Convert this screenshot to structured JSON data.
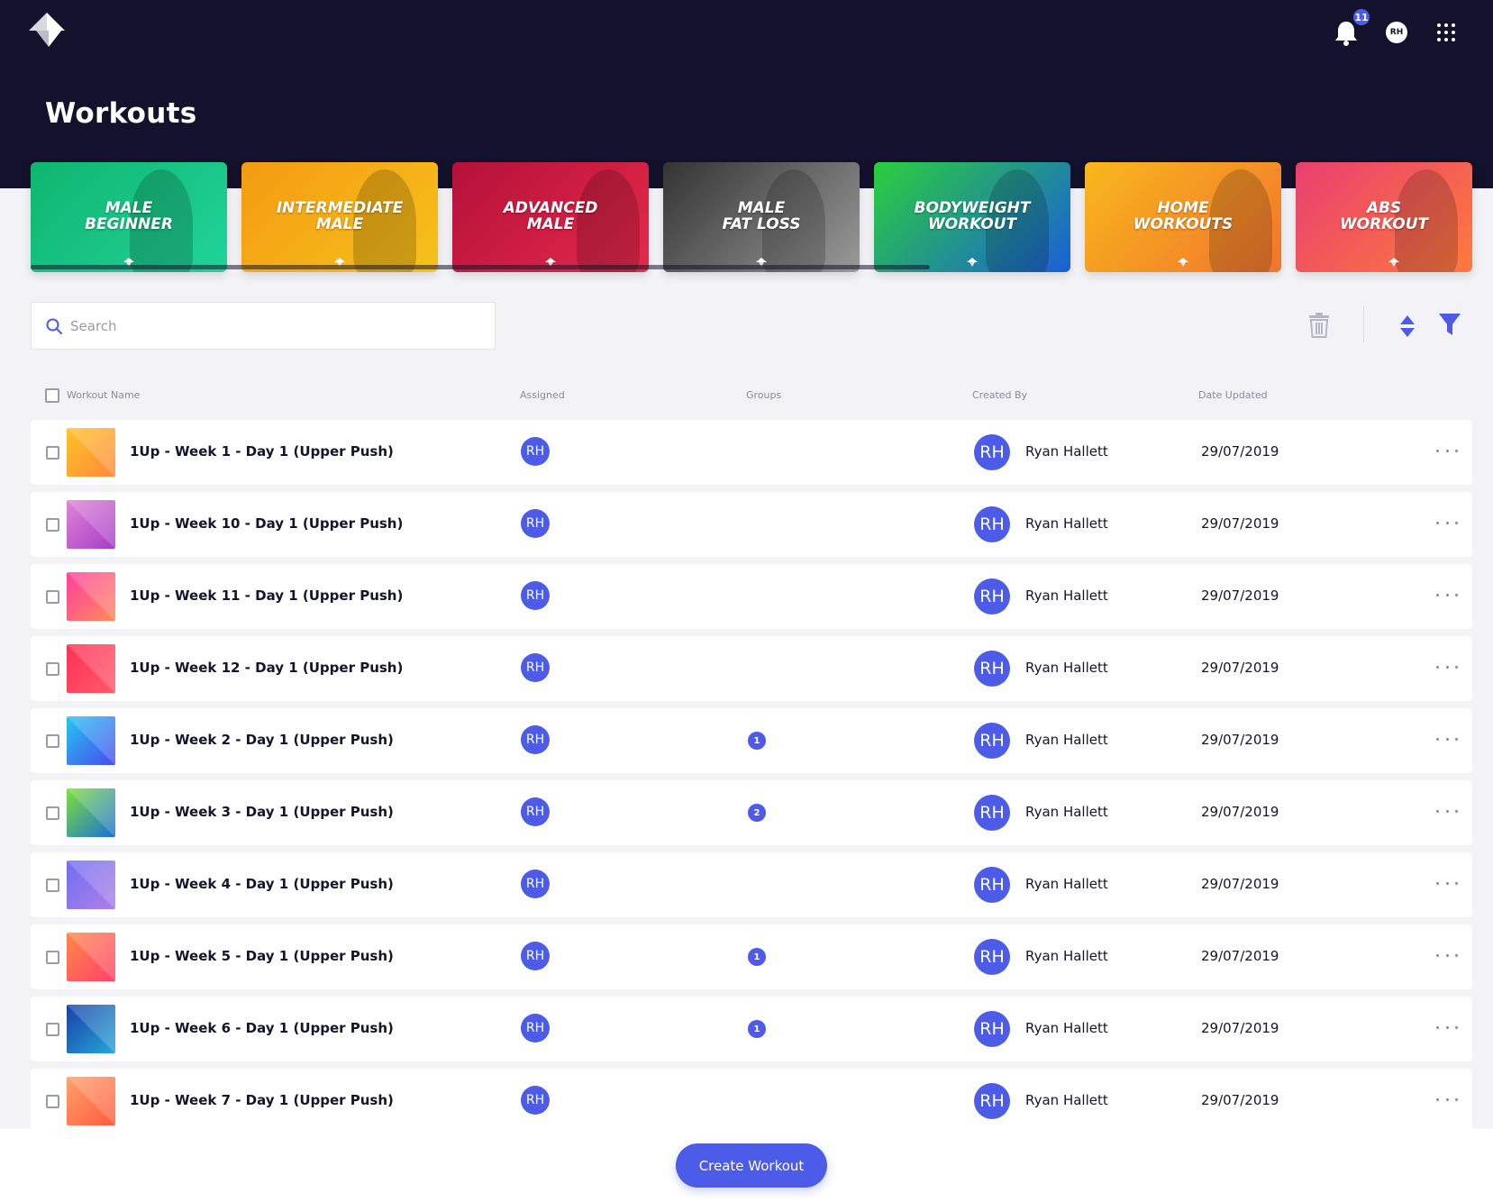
{
  "header": {
    "title": "Workouts",
    "notification_count": "11",
    "user_initials": "RH"
  },
  "categories": [
    {
      "label": "MALE\nBEGINNER",
      "colors": [
        "#0fb56e",
        "#21d39a"
      ]
    },
    {
      "label": "INTERMEDIATE\nMALE",
      "colors": [
        "#f49a12",
        "#f6c21a"
      ]
    },
    {
      "label": "ADVANCED\nMALE",
      "colors": [
        "#b5103a",
        "#e52a4a"
      ]
    },
    {
      "label": "MALE\nFAT LOSS",
      "colors": [
        "#333333",
        "#9a9a9a"
      ]
    },
    {
      "label": "BODYWEIGHT\nWORKOUT",
      "colors": [
        "#2bcf3b",
        "#1a5fd8"
      ]
    },
    {
      "label": "HOME\nWORKOUTS",
      "colors": [
        "#f7b81b",
        "#f2742e"
      ]
    },
    {
      "label": "ABS\nWORKOUT",
      "colors": [
        "#e83f6f",
        "#ff7a3d"
      ]
    }
  ],
  "search": {
    "placeholder": "Search",
    "value": ""
  },
  "table": {
    "columns": [
      "Workout Name",
      "Assigned",
      "Groups",
      "Created By",
      "Date Updated"
    ],
    "rows": [
      {
        "name": "1Up - Week 1 - Day 1 (Upper Push)",
        "assigned": "RH",
        "groups": "",
        "creator_initials": "RH",
        "creator": "Ryan Hallett",
        "date": "29/07/2019",
        "thumb": [
          "#ffc226",
          "#ff8a3d"
        ]
      },
      {
        "name": "1Up - Week 10 - Day 1 (Upper Push)",
        "assigned": "RH",
        "groups": "",
        "creator_initials": "RH",
        "creator": "Ryan Hallett",
        "date": "29/07/2019",
        "thumb": [
          "#e085d6",
          "#a63cc8"
        ]
      },
      {
        "name": "1Up - Week 11 - Day 1 (Upper Push)",
        "assigned": "RH",
        "groups": "",
        "creator_initials": "RH",
        "creator": "Ryan Hallett",
        "date": "29/07/2019",
        "thumb": [
          "#ff3fa0",
          "#ff8a5b"
        ]
      },
      {
        "name": "1Up - Week 12 - Day 1 (Upper Push)",
        "assigned": "RH",
        "groups": "",
        "creator_initials": "RH",
        "creator": "Ryan Hallett",
        "date": "29/07/2019",
        "thumb": [
          "#ff2f55",
          "#ff5a6b"
        ]
      },
      {
        "name": "1Up - Week 2 - Day 1 (Upper Push)",
        "assigned": "RH",
        "groups": "1",
        "creator_initials": "RH",
        "creator": "Ryan Hallett",
        "date": "29/07/2019",
        "thumb": [
          "#25c6f0",
          "#4a4af0"
        ]
      },
      {
        "name": "1Up - Week 3 - Day 1 (Upper Push)",
        "assigned": "RH",
        "groups": "2",
        "creator_initials": "RH",
        "creator": "Ryan Hallett",
        "date": "29/07/2019",
        "thumb": [
          "#7fe03a",
          "#1a6fd8"
        ]
      },
      {
        "name": "1Up - Week 4 - Day 1 (Upper Push)",
        "assigned": "RH",
        "groups": "",
        "creator_initials": "RH",
        "creator": "Ryan Hallett",
        "date": "29/07/2019",
        "thumb": [
          "#6f6ef0",
          "#b07fe8"
        ]
      },
      {
        "name": "1Up - Week 5 - Day 1 (Upper Push)",
        "assigned": "RH",
        "groups": "1",
        "creator_initials": "RH",
        "creator": "Ryan Hallett",
        "date": "29/07/2019",
        "thumb": [
          "#ff8a4a",
          "#ff3f6b"
        ]
      },
      {
        "name": "1Up - Week 6 - Day 1 (Upper Push)",
        "assigned": "RH",
        "groups": "1",
        "creator_initials": "RH",
        "creator": "Ryan Hallett",
        "date": "29/07/2019",
        "thumb": [
          "#1a3fa8",
          "#25a8d8"
        ]
      },
      {
        "name": "1Up - Week 7 - Day 1 (Upper Push)",
        "assigned": "RH",
        "groups": "",
        "creator_initials": "RH",
        "creator": "Ryan Hallett",
        "date": "29/07/2019",
        "thumb": [
          "#ffa26b",
          "#ff5a3d"
        ]
      }
    ]
  },
  "footer": {
    "create_label": "Create Workout"
  },
  "colors": {
    "header_bg": "#13112b",
    "accent": "#4c5ce8",
    "page_bg": "#f3f3f7"
  }
}
